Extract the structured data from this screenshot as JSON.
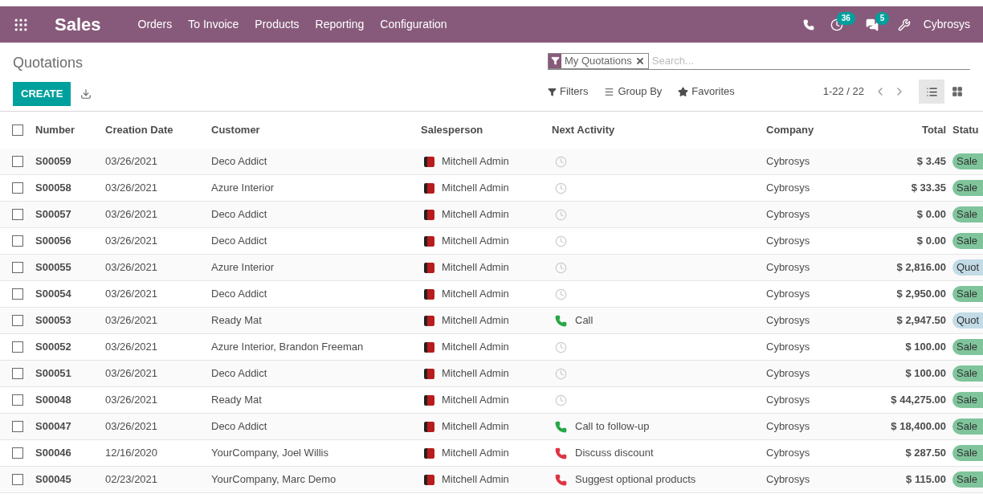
{
  "navbar": {
    "app": "Sales",
    "menu": [
      "Orders",
      "To Invoice",
      "Products",
      "Reporting",
      "Configuration"
    ],
    "activity_count": "36",
    "message_count": "5",
    "company": "Cybrosys"
  },
  "control_panel": {
    "title": "Quotations",
    "create": "CREATE",
    "facet": "My Quotations",
    "search": {
      "placeholder": "Search..."
    },
    "filters": "Filters",
    "group_by": "Group By",
    "favorites": "Favorites",
    "pager": "1-22 / 22",
    "views": [
      {
        "kind": "list",
        "selected": true
      },
      {
        "kind": "kanban",
        "selected": false
      }
    ]
  },
  "table": {
    "select_all": false,
    "columns": [
      "Number",
      "Creation Date",
      "Customer",
      "Salesperson",
      "Next Activity",
      "Company",
      "Total",
      "Statu"
    ],
    "rows": [
      {
        "checked": false,
        "number": "S00059",
        "date": "03/26/2021",
        "customer": "Deco Addict",
        "salesperson": "Mitchell Admin",
        "activity": {
          "kind": "none"
        },
        "company": "Cybrosys",
        "total": "$ 3.45",
        "status": {
          "kind": "sale",
          "label": "Sale"
        }
      },
      {
        "checked": false,
        "number": "S00058",
        "date": "03/26/2021",
        "customer": "Azure Interior",
        "salesperson": "Mitchell Admin",
        "activity": {
          "kind": "none"
        },
        "company": "Cybrosys",
        "total": "$ 33.35",
        "status": {
          "kind": "sale",
          "label": "Sale"
        }
      },
      {
        "checked": false,
        "number": "S00057",
        "date": "03/26/2021",
        "customer": "Deco Addict",
        "salesperson": "Mitchell Admin",
        "activity": {
          "kind": "none"
        },
        "company": "Cybrosys",
        "total": "$ 0.00",
        "status": {
          "kind": "sale",
          "label": "Sale"
        }
      },
      {
        "checked": false,
        "number": "S00056",
        "date": "03/26/2021",
        "customer": "Deco Addict",
        "salesperson": "Mitchell Admin",
        "activity": {
          "kind": "none"
        },
        "company": "Cybrosys",
        "total": "$ 0.00",
        "status": {
          "kind": "sale",
          "label": "Sale"
        }
      },
      {
        "checked": false,
        "number": "S00055",
        "date": "03/26/2021",
        "customer": "Azure Interior",
        "salesperson": "Mitchell Admin",
        "activity": {
          "kind": "none"
        },
        "company": "Cybrosys",
        "total": "$ 2,816.00",
        "status": {
          "kind": "quotation",
          "label": "Quot"
        }
      },
      {
        "checked": false,
        "number": "S00054",
        "date": "03/26/2021",
        "customer": "Deco Addict",
        "salesperson": "Mitchell Admin",
        "activity": {
          "kind": "none"
        },
        "company": "Cybrosys",
        "total": "$ 2,950.00",
        "status": {
          "kind": "sale",
          "label": "Sale"
        }
      },
      {
        "checked": false,
        "number": "S00053",
        "date": "03/26/2021",
        "customer": "Ready Mat",
        "salesperson": "Mitchell Admin",
        "activity": {
          "kind": "planned",
          "label": "Call"
        },
        "company": "Cybrosys",
        "total": "$ 2,947.50",
        "status": {
          "kind": "quotation",
          "label": "Quot"
        }
      },
      {
        "checked": false,
        "number": "S00052",
        "date": "03/26/2021",
        "customer": "Azure Interior, Brandon Freeman",
        "salesperson": "Mitchell Admin",
        "activity": {
          "kind": "none"
        },
        "company": "Cybrosys",
        "total": "$ 100.00",
        "status": {
          "kind": "sale",
          "label": "Sale"
        }
      },
      {
        "checked": false,
        "number": "S00051",
        "date": "03/26/2021",
        "customer": "Deco Addict",
        "salesperson": "Mitchell Admin",
        "activity": {
          "kind": "none"
        },
        "company": "Cybrosys",
        "total": "$ 100.00",
        "status": {
          "kind": "sale",
          "label": "Sale"
        }
      },
      {
        "checked": false,
        "number": "S00048",
        "date": "03/26/2021",
        "customer": "Ready Mat",
        "salesperson": "Mitchell Admin",
        "activity": {
          "kind": "none"
        },
        "company": "Cybrosys",
        "total": "$ 44,275.00",
        "status": {
          "kind": "sale",
          "label": "Sale"
        }
      },
      {
        "checked": false,
        "number": "S00047",
        "date": "03/26/2021",
        "customer": "Deco Addict",
        "salesperson": "Mitchell Admin",
        "activity": {
          "kind": "planned",
          "label": "Call to follow-up"
        },
        "company": "Cybrosys",
        "total": "$ 18,400.00",
        "status": {
          "kind": "sale",
          "label": "Sale"
        }
      },
      {
        "checked": false,
        "number": "S00046",
        "date": "12/16/2020",
        "customer": "YourCompany, Joel Willis",
        "salesperson": "Mitchell Admin",
        "activity": {
          "kind": "overdue",
          "label": "Discuss discount"
        },
        "company": "Cybrosys",
        "total": "$ 287.50",
        "status": {
          "kind": "sale",
          "label": "Sale"
        }
      },
      {
        "checked": false,
        "number": "S00045",
        "date": "02/23/2021",
        "customer": "YourCompany, Marc Demo",
        "salesperson": "Mitchell Admin",
        "activity": {
          "kind": "overdue",
          "label": "Suggest optional products"
        },
        "company": "Cybrosys",
        "total": "$ 115.00",
        "status": {
          "kind": "sale",
          "label": "Sale"
        }
      }
    ]
  }
}
